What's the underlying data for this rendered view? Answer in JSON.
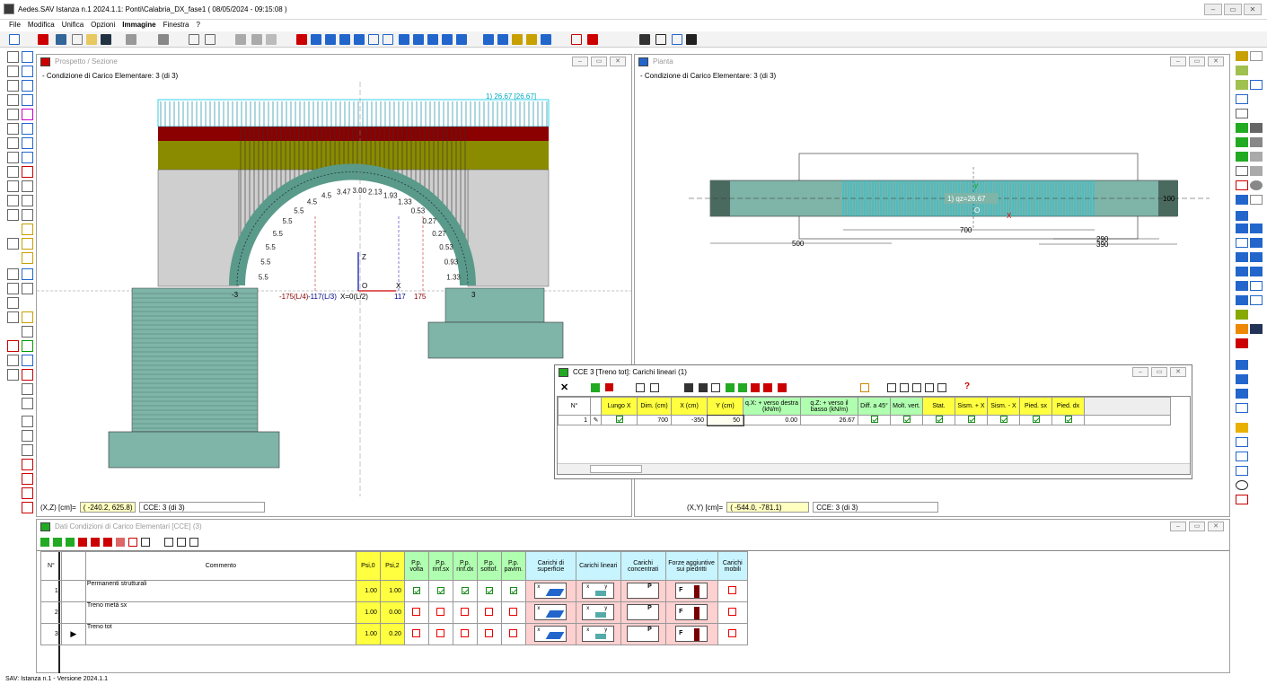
{
  "app": {
    "title": "Aedes.SAV Istanza n.1 2024.1.1: Ponti\\Calabria_DX_fase1  ( 08/05/2024 - 09:15:08 )",
    "menu": [
      "File",
      "Modifica",
      "Unifica",
      "Opzioni",
      "Immagine",
      "Finestra",
      "?"
    ],
    "active_menu": "Immagine",
    "window_controls": [
      "–",
      "▭",
      "✕"
    ],
    "status": "SAV: Istanza n.1 - Versione 2024.1.1"
  },
  "prospetto": {
    "title": "Prospetto / Sezione",
    "subtitle": "- Condizione di Carico Elementare: 3  (di 3)",
    "load_label": "1) 26.67 [26.67]",
    "coord_label": "(X,Z) [cm]=",
    "coord_value": "( -240.2, 625.8)",
    "cce_label": "CCE: 3  (di 3)",
    "axis_labels": {
      "x_left": "-175(L/4)",
      "x_mid": "-117(L/3)",
      "x_zero": "X=0(L/2)",
      "x_117": "117",
      "x_175": "175",
      "left_end": "-3",
      "right_end": "3",
      "z": "Z",
      "x": "X",
      "o": "O"
    },
    "arc_values": [
      "5.5",
      "5.5",
      "5.5",
      "5.5",
      "5.5",
      "5.5",
      "4.5",
      "4.5",
      "3.47",
      "3.00",
      "2.13",
      "1.93",
      "1.33",
      "0.53",
      "0.27",
      "0.27",
      "0.53",
      "0.93",
      "1.33"
    ]
  },
  "pianta": {
    "title": "Pianta",
    "subtitle": "- Condizione di Carico Elementare: 3  (di 3)",
    "load_label": "1) qz=26.67",
    "dims": {
      "d700": "700",
      "d500": "500",
      "d290": "290",
      "d390": "390",
      "d100": "100"
    },
    "axis": {
      "y": "y",
      "x": "X",
      "o": "O"
    },
    "coord_label": "(X,Y) [cm]=",
    "coord_value": "( -544.0, -781.1)",
    "cce_label": "CCE: 3  (di 3)"
  },
  "cce3": {
    "title": "CCE 3 [Treno tot]: Carichi lineari (1)",
    "headers": [
      "N°",
      "",
      "Lungo X",
      "Dim. (cm)",
      "X (cm)",
      "Y (cm)",
      "q.X: + verso destra (kN/m)",
      "q.Z: + verso il basso (kN/m)",
      "Diff. a 45°",
      "Molt. vert.",
      "Stat.",
      "Sism. + X",
      "Sism. - X",
      "Pied. sx",
      "Pied. dx"
    ],
    "row": {
      "n": "1",
      "lungo_x": true,
      "dim": "700",
      "x": "-350",
      "y": "50",
      "qx": "0.00",
      "qz": "26.67",
      "diff": true,
      "molt": true,
      "stat": true,
      "sismp": true,
      "sismm": true,
      "pieds": true,
      "piedd": true
    },
    "close": "✕",
    "help": "?"
  },
  "dati": {
    "title": "Dati Condizioni di Carico Elementari [CCE] (3)",
    "headers": {
      "n": "N°",
      "commento": "Commento",
      "psi0": "Psi,0",
      "psi2": "Psi,2",
      "pp_volta": "P.p. volta",
      "pp_rinfsx": "P.p. rinf.sx",
      "pp_rinfdx": "P.p. rinf.dx",
      "pp_sottof": "P.p. sottof.",
      "pp_pavim": "P.p. pavim.",
      "superficie": "Carichi di superficie",
      "lineari": "Carichi lineari",
      "concentrati": "Carichi concentrati",
      "forze": "Forze aggiuntive sui piedritti",
      "mobili": "Carichi mobili"
    },
    "rows": [
      {
        "n": "1",
        "commento": "Permanenti strutturali",
        "psi0": "1.00",
        "psi2": "1.00",
        "checks": [
          true,
          true,
          true,
          true,
          true
        ],
        "current": false
      },
      {
        "n": "2",
        "commento": "Treno metà sx",
        "psi0": "1.00",
        "psi2": "0.00",
        "checks": [
          false,
          false,
          false,
          false,
          false
        ],
        "current": false
      },
      {
        "n": "3",
        "commento": "Treno tot",
        "psi0": "1.00",
        "psi2": "0.20",
        "checks": [
          false,
          false,
          false,
          false,
          false
        ],
        "current": true
      }
    ],
    "icon_letters": {
      "x": "x",
      "y": "y",
      "p": "P",
      "f": "F"
    }
  },
  "colors": {
    "accent_red": "#cc0000",
    "wall_dark_red": "#8b0000",
    "fill_olive": "#8b8b00",
    "pier_teal": "#7fb4a8",
    "load_cyan": "#00c8e6"
  }
}
